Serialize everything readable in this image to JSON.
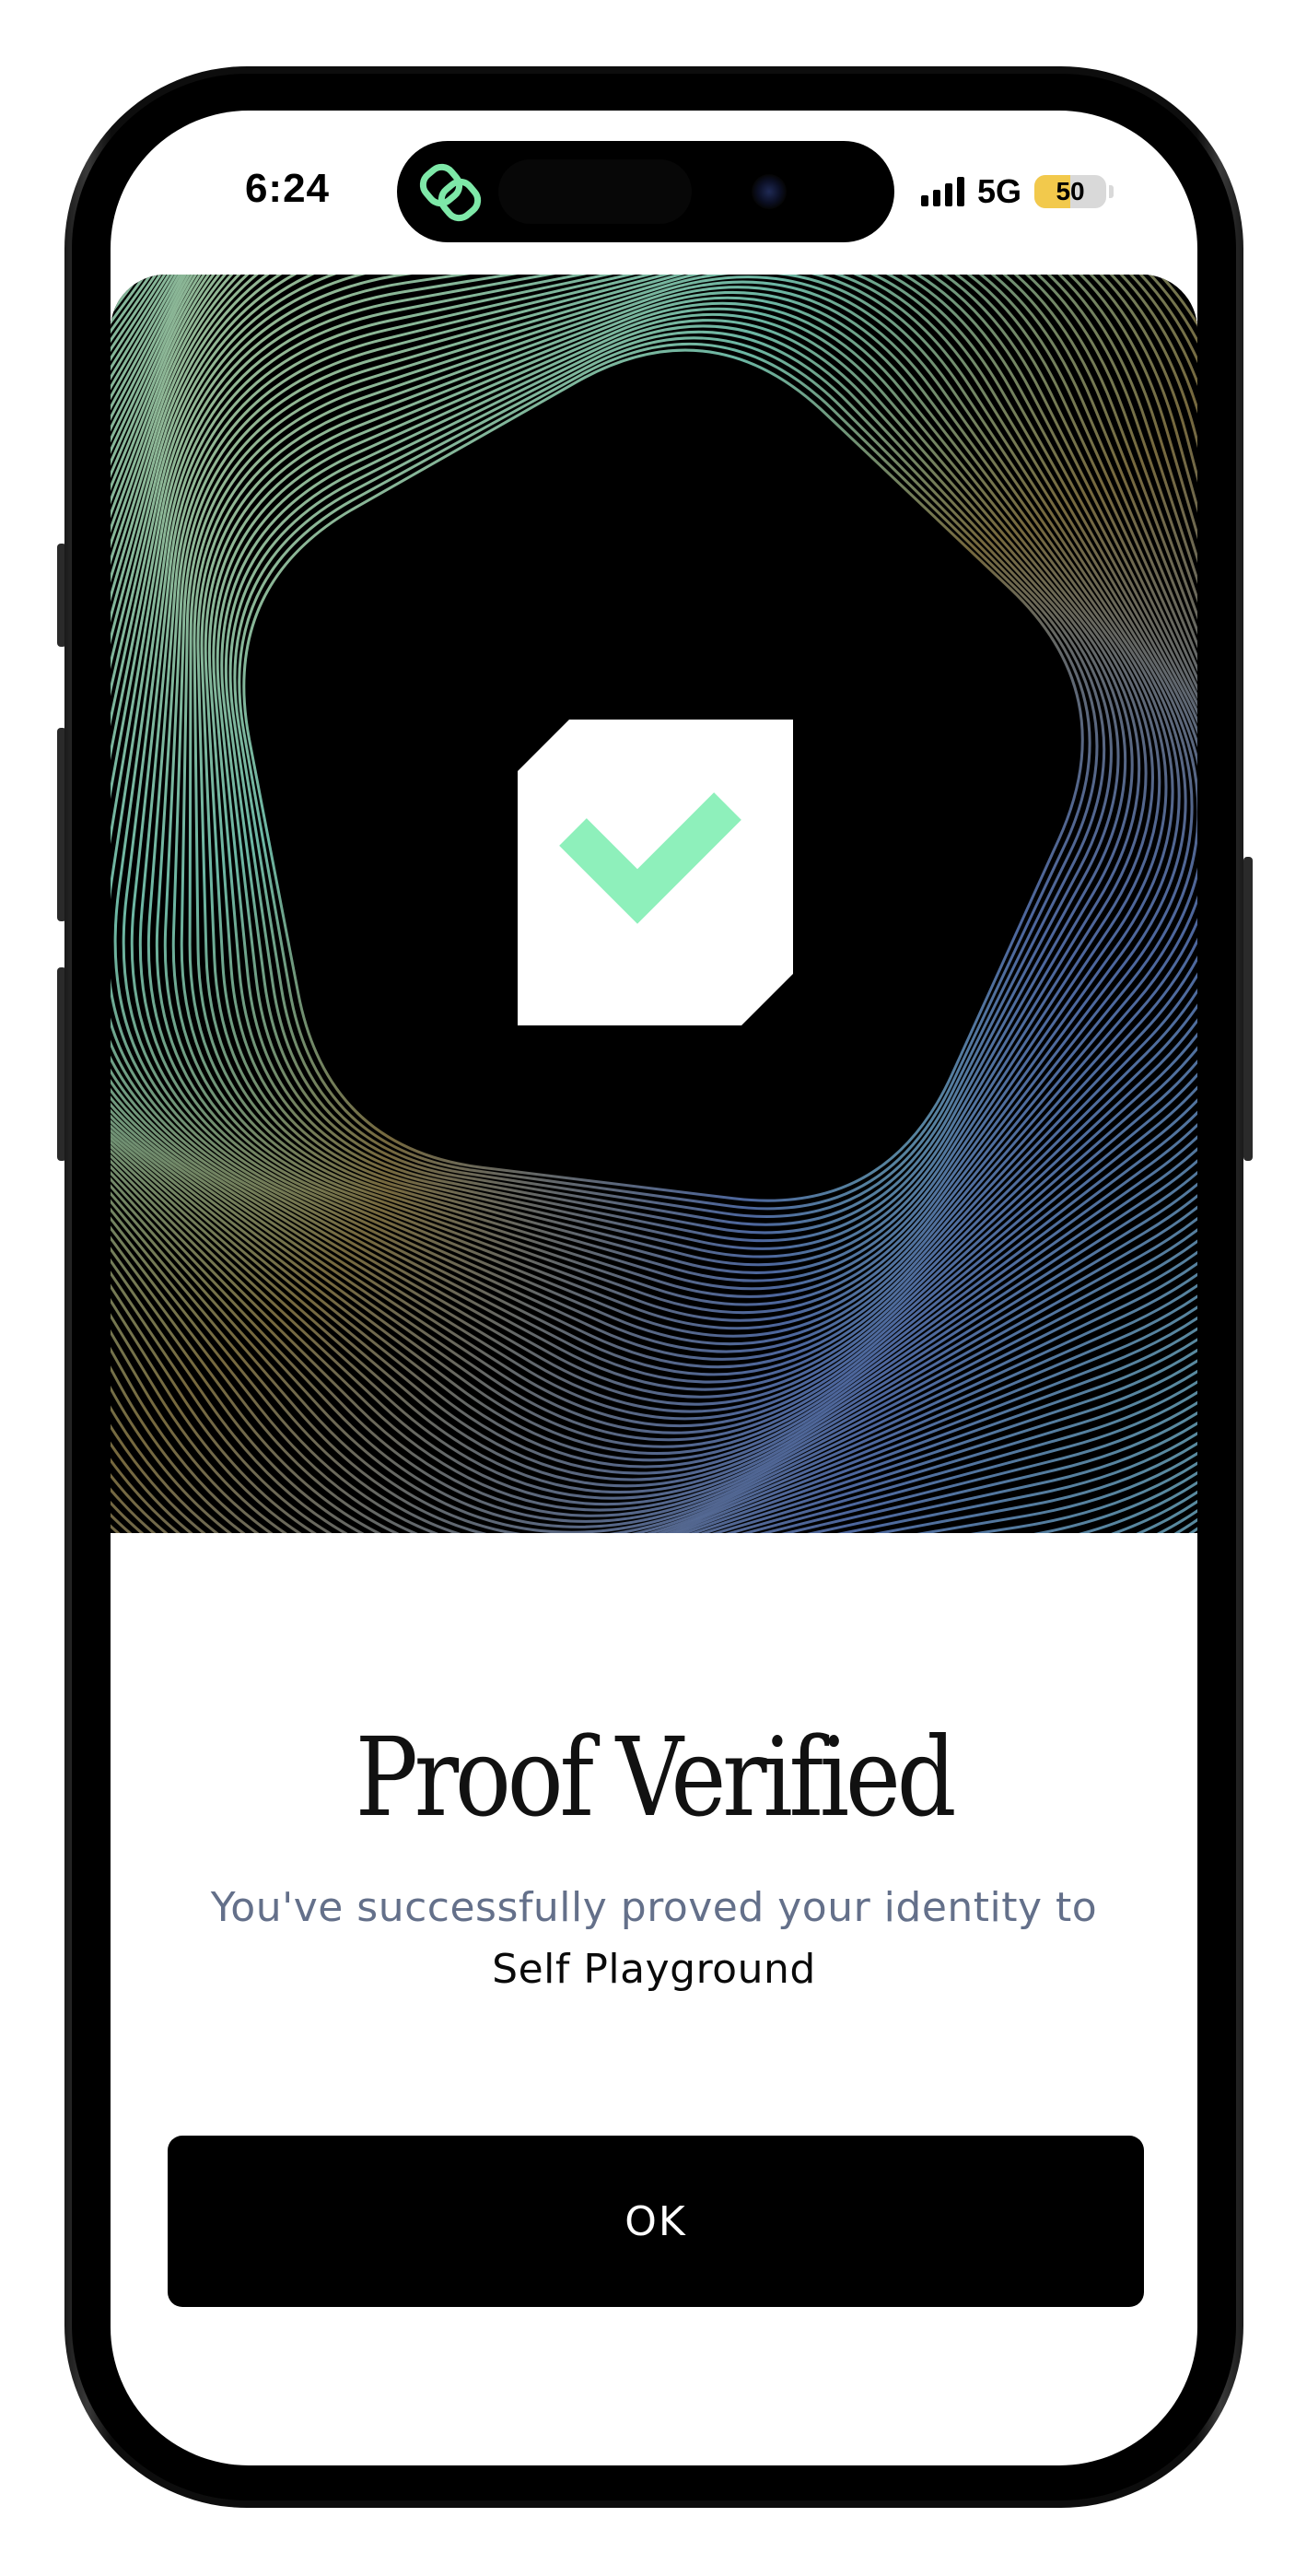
{
  "status_bar": {
    "time": "6:24",
    "network": "5G",
    "battery_level": "50",
    "battery_fraction": 0.5,
    "battery_color": "#f2c94c",
    "signal_bars": 4
  },
  "dynamic_island": {
    "app_icon": "linked-rings-icon",
    "app_icon_color": "#7ee8a8"
  },
  "hero": {
    "icon": "verified-check-icon",
    "check_color": "#8ef0bb",
    "badge_color": "#ffffff"
  },
  "content": {
    "title": "Proof Verified",
    "subtitle": "You've successfully proved your identity to",
    "app_name": "Self Playground"
  },
  "actions": {
    "ok_label": "OK"
  }
}
